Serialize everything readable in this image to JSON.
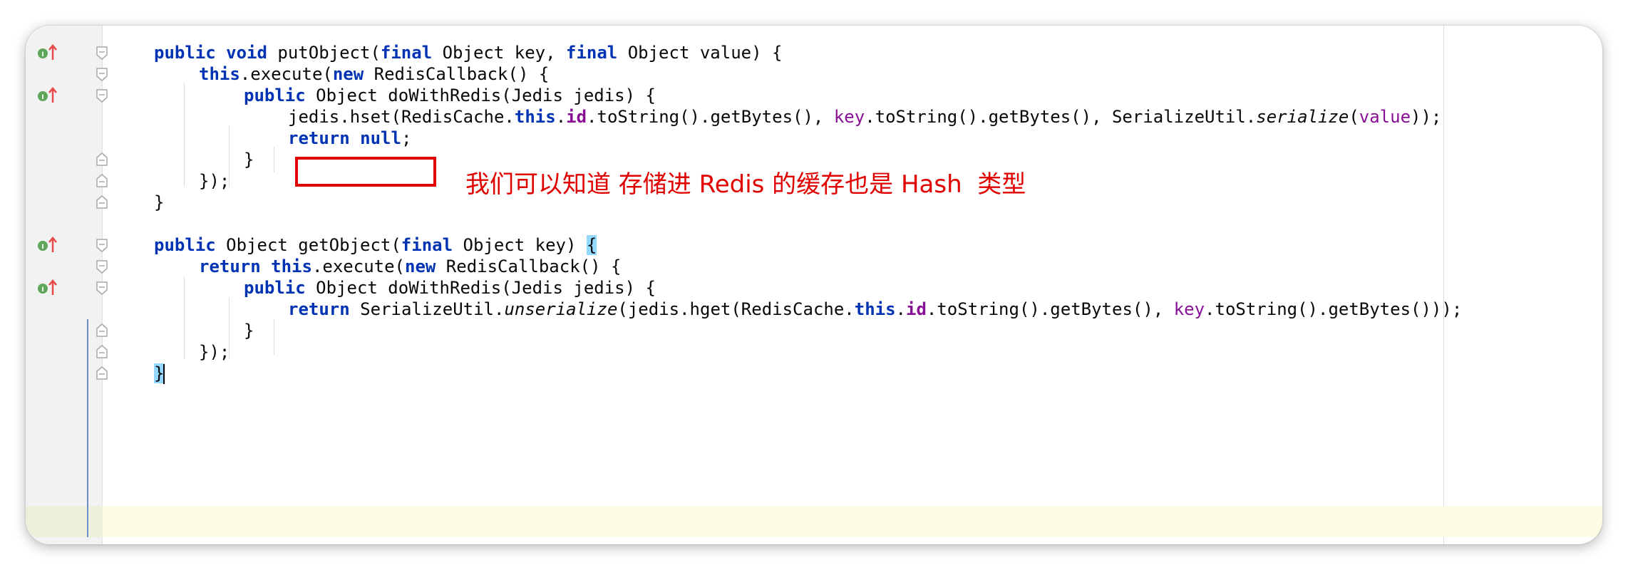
{
  "editor": {
    "lines": [
      {
        "id": "l1",
        "text": ""
      },
      {
        "id": "l2",
        "text": ""
      }
    ]
  },
  "code": {
    "put_sig": {
      "kw_public": "public",
      "kw_void": "void",
      "name": "putObject(",
      "kw_final1": "final",
      "p1": " Object key, ",
      "kw_final2": "final",
      "p2": " Object value) {"
    },
    "put_exec": {
      "kw_this": "this",
      ".exec": ".execute(",
      "kw_new": "new",
      "rest": " RedisCallback() {"
    },
    "put_inner_sig": {
      "kw_public": "public",
      "rest": " Object doWithRedis(Jedis jedis) {"
    },
    "put_hset": {
      "a": "jedis.hset(RedisCache.",
      "kw_this": "this",
      "b": ".",
      "id": "id",
      "c": ".toString().getBytes(), ",
      "key": "key",
      "d": ".toString().getBytes(), SerializeUtil.",
      "m": "serialize",
      "e": "(",
      "val": "value",
      "f": "));"
    },
    "put_return": {
      "kw_return": "return",
      "kw_null": "null",
      ";": ";"
    },
    "put_close_inner": "}",
    "put_close_cb": "});",
    "put_close": "}",
    "get_sig": {
      "kw_public": "public",
      "a": " Object getObject(",
      "kw_final": "final",
      "b": " Object key) ",
      "brace": "{"
    },
    "get_exec": {
      "kw_return": "return",
      "kw_this": "this",
      "a": ".execute(",
      "kw_new": "new",
      "b": " RedisCallback() {"
    },
    "get_inner_sig": {
      "kw_public": "public",
      "rest": " Object doWithRedis(Jedis jedis) {"
    },
    "get_return": {
      "kw_return": "return",
      "a": " SerializeUtil.",
      "m": "unserialize",
      "b": "(jedis.hget(RedisCache.",
      "kw_this": "this",
      "c": ".",
      "id": "id",
      "d": ".toString().getBytes(), ",
      "key": "key",
      "e": ".toString().getBytes()));"
    },
    "get_close_inner": "}",
    "get_close_cb": "});",
    "get_close": "}"
  },
  "annotation": {
    "text": "我们可以知道 存储进 Redis 的缓存也是 Hash  类型"
  },
  "gutter_icons": [
    "implements-icon",
    "implements-icon",
    "implements-icon",
    "implements-icon"
  ],
  "colors": {
    "keyword": "#0033b3",
    "field": "#871094",
    "annotation_red": "#e00000",
    "current_line": "#fdfce5",
    "brace_match": "#93d9ff"
  }
}
